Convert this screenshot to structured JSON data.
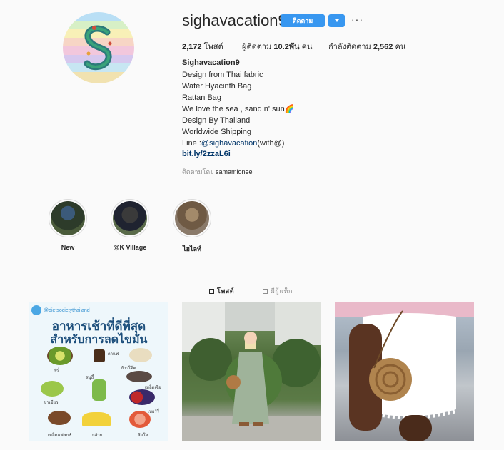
{
  "profile": {
    "username": "sighavacation9",
    "follow_label": "ติดตาม",
    "more_label": "···",
    "stats": {
      "posts": "2,172",
      "posts_label": "โพสต์",
      "followers_prefix": "ผู้ติดตาม",
      "followers": "10.2พัน",
      "followers_suffix": "คน",
      "following_prefix": "กำลังติดตาม",
      "following": "2,562",
      "following_suffix": "คน"
    },
    "bio": {
      "name": "Sighavacation9",
      "lines": [
        "Design from Thai fabric",
        "Water Hyacinth Bag",
        "Rattan Bag",
        "We love the sea , sand n' sun🌈",
        "Design By Thailand",
        "Worldwide Shipping"
      ],
      "line_prefix": "Line :",
      "line_handle": "@sighavacation",
      "line_suffix": "(with@)",
      "url": "bit.ly/2zzaL6i"
    },
    "followed_by_prefix": "ติดตามโดย",
    "followed_by_user": "samamionee"
  },
  "highlights": [
    {
      "label": "New"
    },
    {
      "label": "@K Village"
    },
    {
      "label": "ไฮไลท์"
    }
  ],
  "tabs": [
    {
      "label": "โพสต์",
      "active": true
    },
    {
      "label": "มีผู้แท็ก",
      "active": false
    }
  ],
  "posts": [
    {
      "brand": "@dietsocietythailand",
      "title_line1": "อาหารเช้าที่ดีที่สุด",
      "title_line2": "สำหรับการลดไขมัน",
      "foods": [
        "กีวี่",
        "กาแฟ",
        "ข้าวโอ๊ต",
        "สมูธี้",
        "ชาเขียว",
        "เมล็ดเจีย",
        "เบอร์รี่",
        "เมล็ดแฟลกซ์",
        "กล้วย",
        "ส้มโอ"
      ]
    },
    {},
    {}
  ],
  "colors": {
    "accent": "#3897f0",
    "link": "#003569",
    "muted": "#8e8e8e",
    "border": "#dbdbdb"
  }
}
